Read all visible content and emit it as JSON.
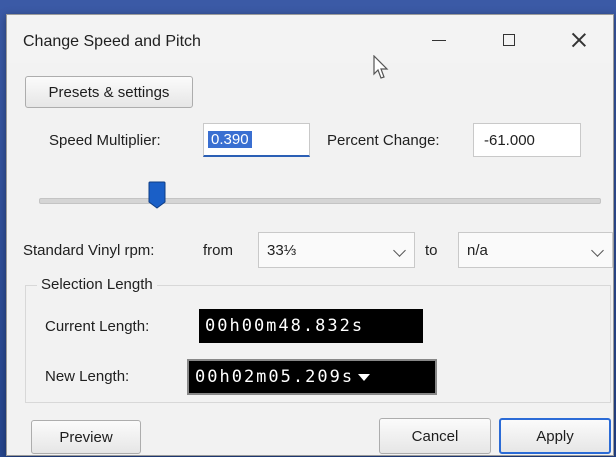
{
  "window": {
    "title": "Change Speed and Pitch"
  },
  "presets": {
    "label": "Presets & settings"
  },
  "speed": {
    "label": "Speed Multiplier:",
    "value": "0.390"
  },
  "percent": {
    "label": "Percent Change:",
    "value": "-61.000"
  },
  "slider": {
    "value_fraction": 0.21
  },
  "vinyl": {
    "label": "Standard Vinyl rpm:",
    "from_label": "from",
    "from_value": "33⅓",
    "to_label": "to",
    "to_value": "n/a"
  },
  "selection": {
    "group_title": "Selection Length",
    "current_label": "Current Length:",
    "current_value": "00h00m48.832s",
    "new_label": "New Length:",
    "new_value": "00h02m05.209s"
  },
  "buttons": {
    "preview": "Preview",
    "cancel": "Cancel",
    "apply": "Apply"
  },
  "icons": {
    "minimize": "minimize-icon",
    "maximize": "maximize-icon",
    "close": "close-icon",
    "cursor": "mouse-cursor-icon",
    "dropdown": "chevron-down-icon"
  },
  "colors": {
    "accent": "#2b6bd6",
    "selection": "#3a6fd1"
  }
}
